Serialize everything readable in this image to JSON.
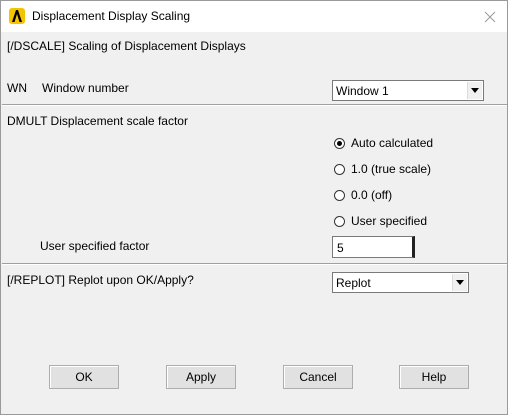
{
  "window": {
    "title": "Displacement Display Scaling"
  },
  "header": {
    "text": "[/DSCALE]  Scaling of Displacement Displays"
  },
  "wn": {
    "code": "WN",
    "label": "Window number",
    "selected": "Window 1"
  },
  "dmult": {
    "label": "DMULT  Displacement scale factor",
    "options": [
      {
        "label": "Auto calculated",
        "checked": true
      },
      {
        "label": "1.0 (true scale)",
        "checked": false
      },
      {
        "label": "0.0 (off)",
        "checked": false
      },
      {
        "label": "User specified",
        "checked": false
      }
    ],
    "factor_label": "User specified factor",
    "factor_value": "5"
  },
  "replot": {
    "label": "[/REPLOT] Replot upon OK/Apply?",
    "selected": "Replot"
  },
  "buttons": {
    "ok": "OK",
    "apply": "Apply",
    "cancel": "Cancel",
    "help": "Help"
  },
  "icons": {
    "app": "ansys-logo-icon",
    "close": "close-icon",
    "dropdown": "chevron-down-icon"
  },
  "colors": {
    "app_icon": "#f5c400",
    "dialog_bg": "#f0f0f0"
  }
}
